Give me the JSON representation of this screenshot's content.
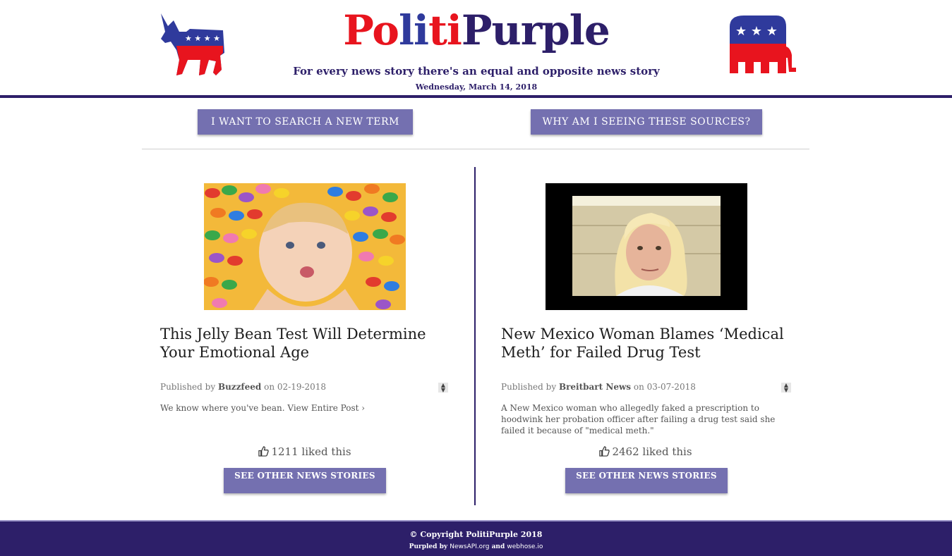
{
  "header": {
    "title_parts": [
      "Po",
      "li",
      "ti",
      "Purple"
    ],
    "title_colors": [
      "#e8141e",
      "#2f3a9c",
      "#e8141e",
      "#2d1f69"
    ],
    "tagline": "For every news story there's an equal and opposite news story",
    "date": "Wednesday, March 14, 2018"
  },
  "actions": {
    "search_label": "I WANT TO SEARCH A NEW TERM",
    "why_label": "WHY AM I SEEING THESE SOURCES?"
  },
  "articles": [
    {
      "headline": "This Jelly Bean Test Will Determine Your Emotional Age",
      "published_prefix": "Published by",
      "source": "Buzzfeed",
      "on": "on",
      "date": "02-19-2018",
      "description": "We know where you've bean.",
      "link": "View Entire Post ›",
      "likes": "1211 liked this",
      "button": "SEE OTHER NEWS STORIES",
      "image": "baby-jelly-beans"
    },
    {
      "headline": "New Mexico Woman Blames ‘Medical Meth’ for Failed Drug Test",
      "published_prefix": "Published by",
      "source": "Breitbart News",
      "on": "on",
      "date": "03-07-2018",
      "description": "A New Mexico woman who allegedly faked a prescription to hoodwink her probation officer after failing a drug test said she failed it because of \"medical meth.\"",
      "link": "",
      "likes": "2462 liked this",
      "button": "SEE OTHER NEWS STORIES",
      "image": "mugshot"
    }
  ],
  "footer": {
    "copyright": "© Copyright PolitiPurple 2018",
    "purpled_by": "Purpled by",
    "source1": "NewsAPI.org",
    "and": "and",
    "source2": "webhose.io"
  },
  "colors": {
    "brand_purple": "#2d1f69",
    "button": "#7470b0",
    "dem_blue": "#2f3a9c",
    "rep_red": "#e8141e"
  }
}
